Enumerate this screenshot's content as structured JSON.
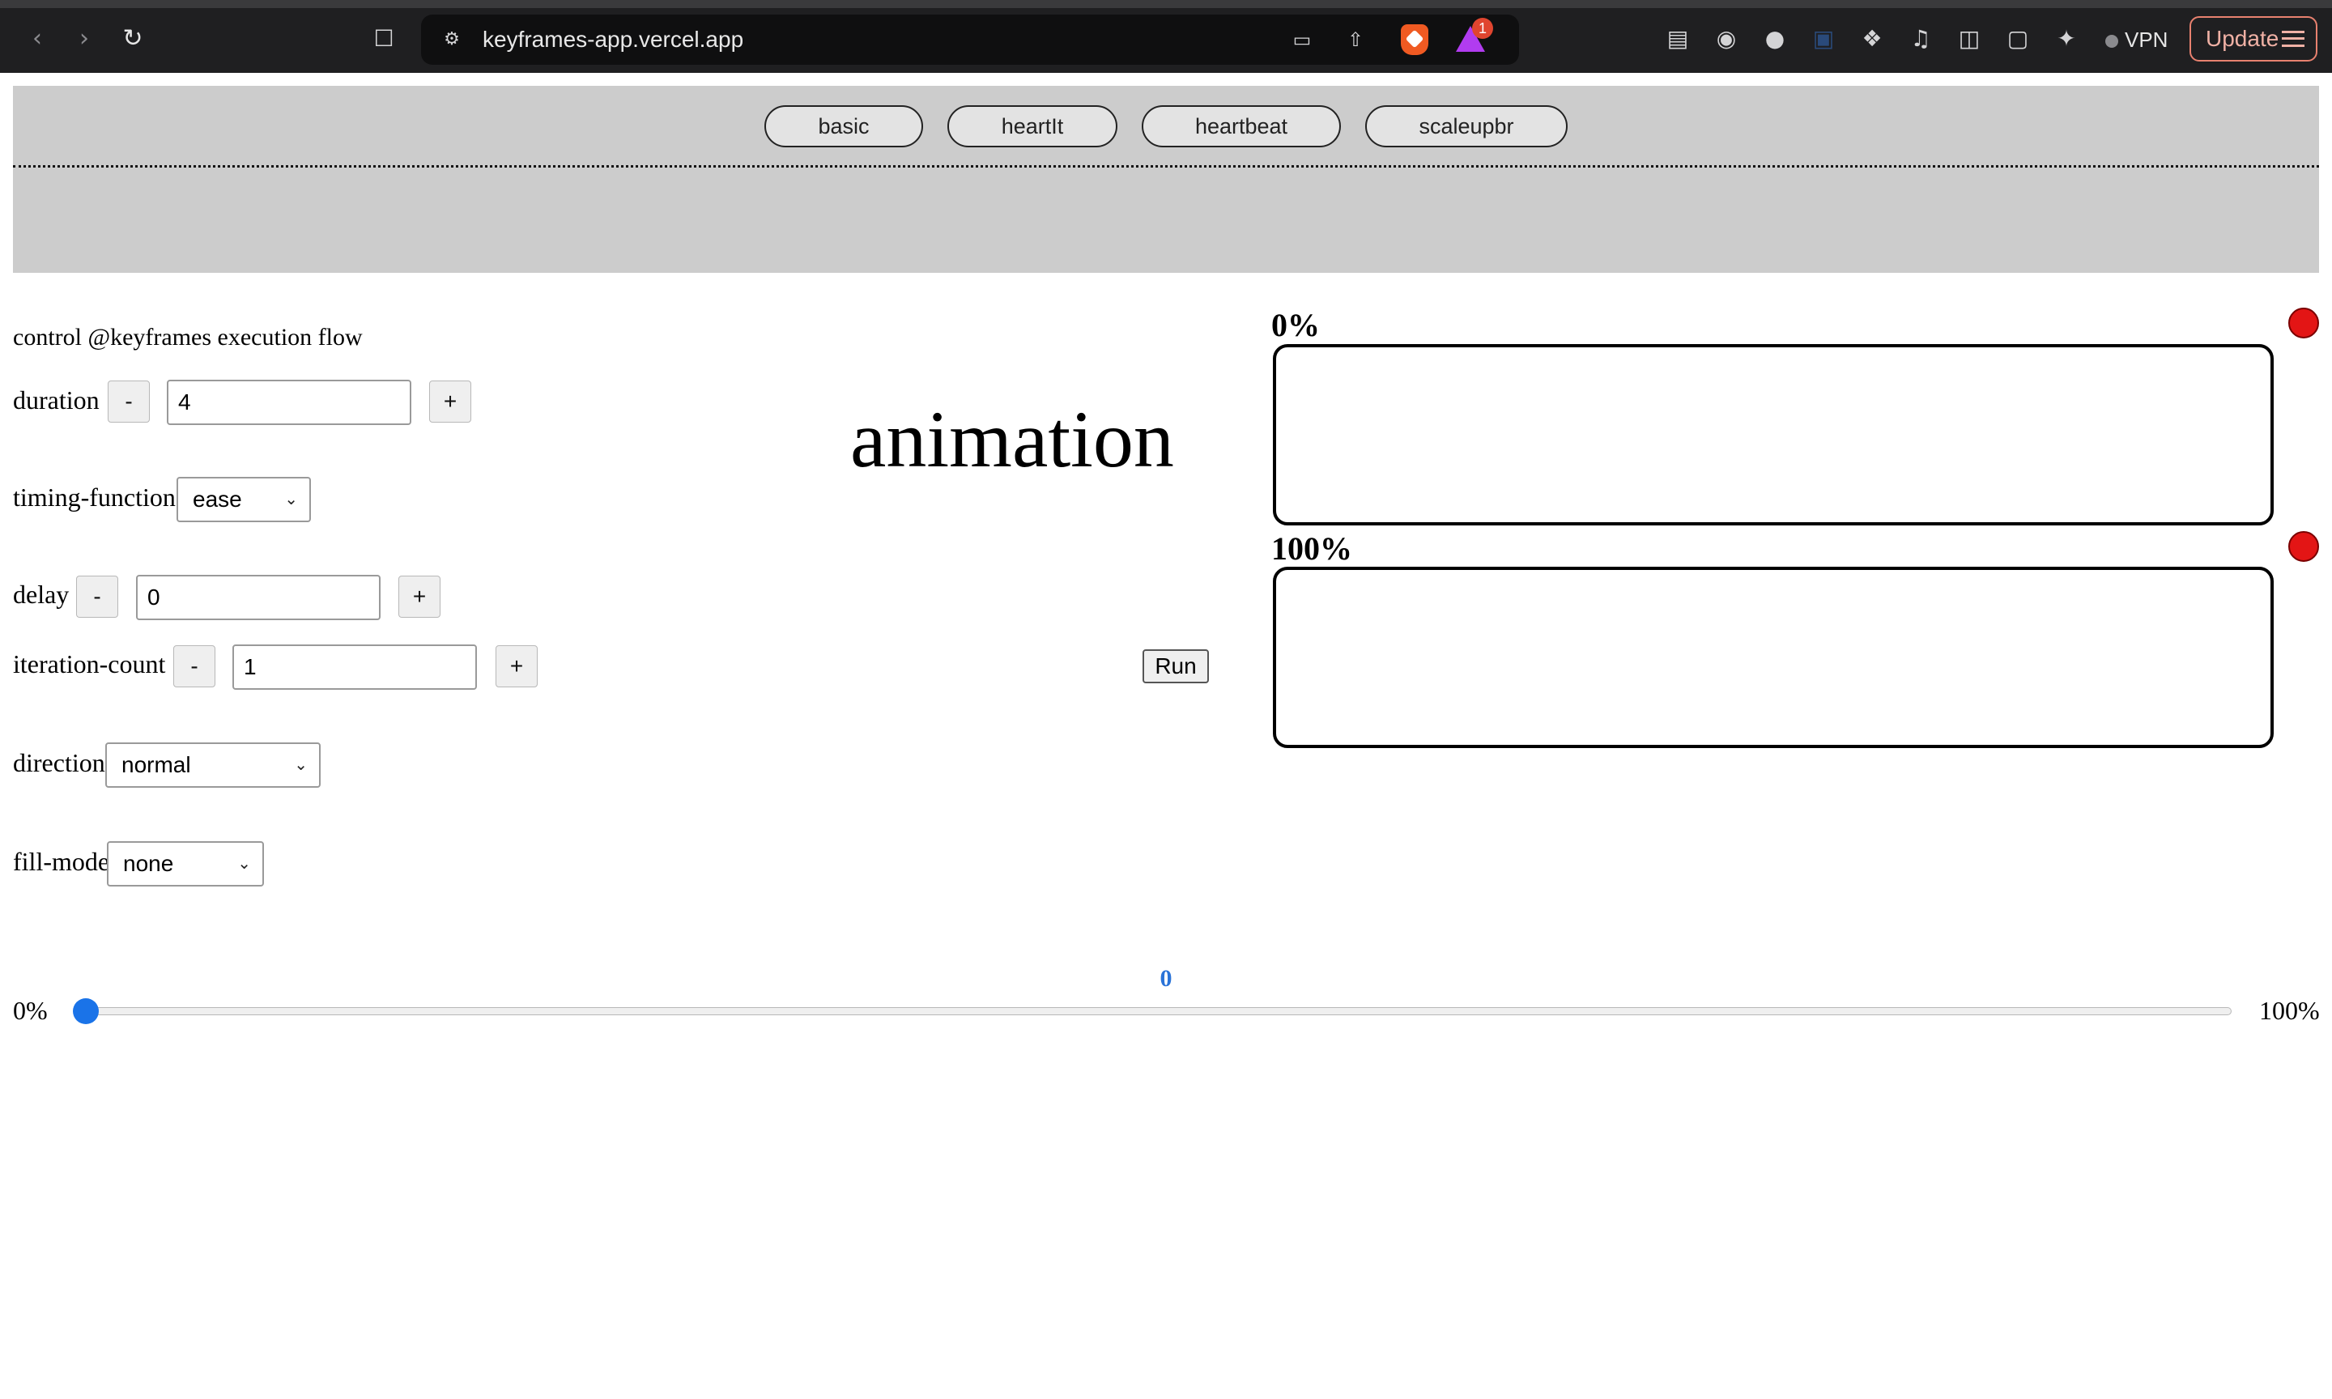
{
  "browser": {
    "url": "keyframes-app.vercel.app",
    "vpn_label": "VPN",
    "update_label": "Update",
    "rewards_badge": "1"
  },
  "presets": [
    {
      "label": "basic"
    },
    {
      "label": "heartIt"
    },
    {
      "label": "heartbeat"
    },
    {
      "label": "scaleupbr"
    }
  ],
  "controls": {
    "heading": "control @keyframes execution flow",
    "duration": {
      "label": "duration",
      "value": "4",
      "minus": "-",
      "plus": "+"
    },
    "timing_function": {
      "label": "timing-function",
      "value": "ease"
    },
    "delay": {
      "label": "delay",
      "value": "0",
      "minus": "-",
      "plus": "+"
    },
    "iteration_count": {
      "label": "iteration-count",
      "value": "1",
      "minus": "-",
      "plus": "+"
    },
    "direction": {
      "label": "direction",
      "value": "normal"
    },
    "fill_mode": {
      "label": "fill-mode",
      "value": "none"
    }
  },
  "preview": {
    "text": "animation",
    "run_label": "Run"
  },
  "keyframes": [
    {
      "label": "0%"
    },
    {
      "label": "100%"
    }
  ],
  "timeline": {
    "min_label": "0%",
    "max_label": "100%",
    "value": "0",
    "value_fraction": 0
  },
  "colors": {
    "banner_bg": "#cccccc",
    "slider_accent": "#1a73e8",
    "keyframe_dot": "#e31515"
  }
}
